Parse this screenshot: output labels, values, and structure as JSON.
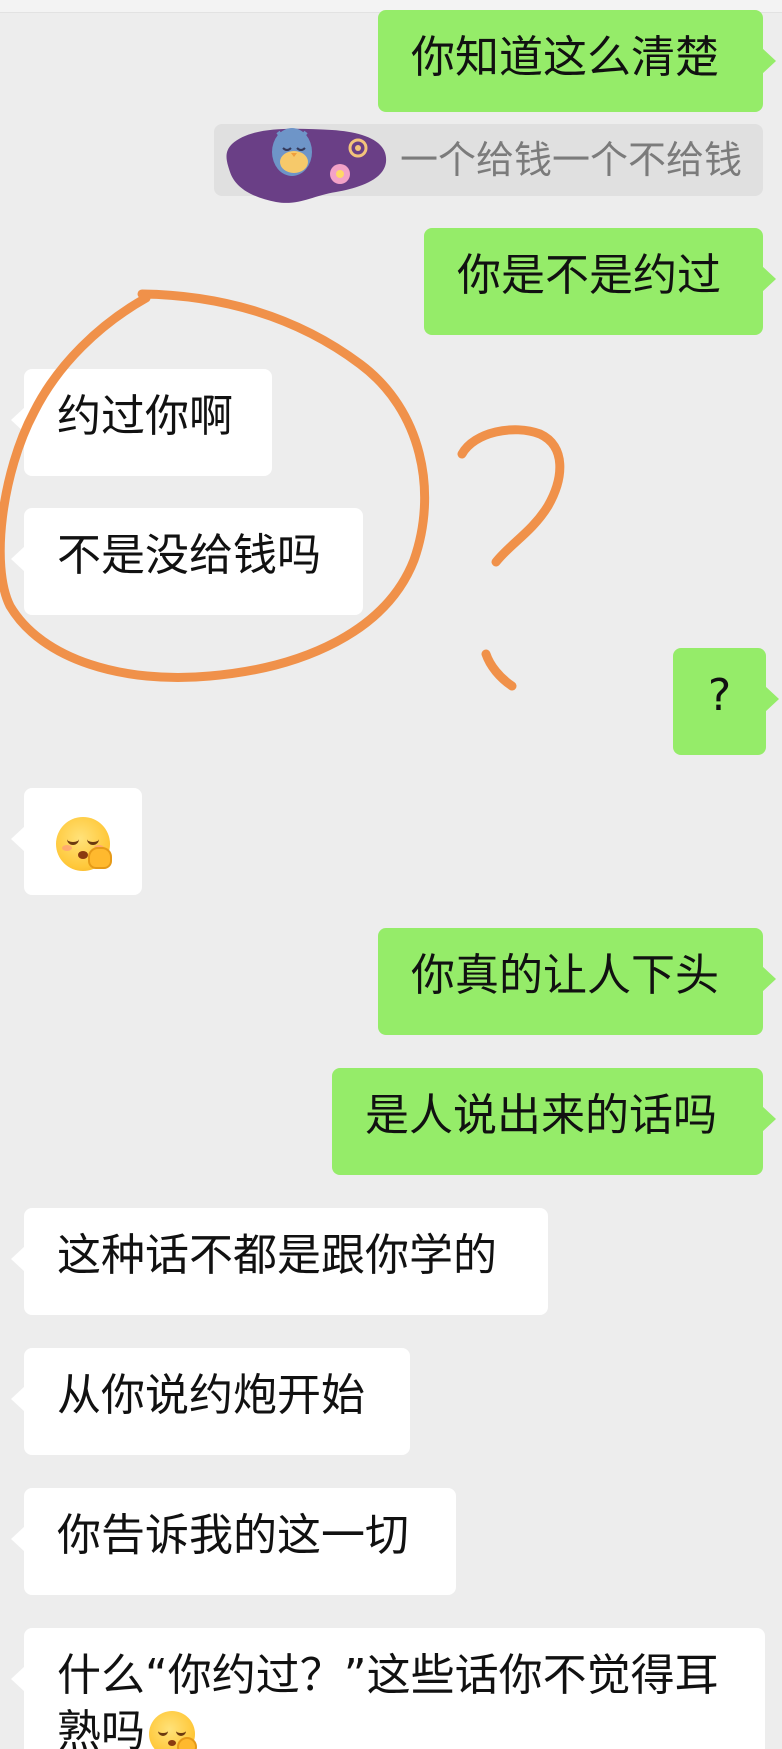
{
  "chat": {
    "messages": [
      {
        "side": "out",
        "text": "你知道这么清楚"
      },
      {
        "side": "quote",
        "text": "一个给钱一个不给钱"
      },
      {
        "side": "out",
        "text": "你是不是约过"
      },
      {
        "side": "in",
        "text": "约过你啊"
      },
      {
        "side": "in",
        "text": "不是没给钱吗"
      },
      {
        "side": "out",
        "text": "?"
      },
      {
        "side": "in",
        "text": "",
        "icon": "smirk-shushing-emoji-icon"
      },
      {
        "side": "out",
        "text": "你真的让人下头"
      },
      {
        "side": "out",
        "text": "是人说出来的话吗"
      },
      {
        "side": "in",
        "text": "这种话不都是跟你学的"
      },
      {
        "side": "in",
        "text": "从你说约炮开始"
      },
      {
        "side": "in",
        "text": "你告诉我的这一切"
      },
      {
        "side": "in",
        "text": "什么“你约过？”这些话你不觉得耳熟吗",
        "icon": "smirk-shushing-emoji-icon"
      }
    ]
  },
  "annotation": {
    "color": "#f0914a",
    "shapes": [
      "circle-icon",
      "question-mark-icon"
    ]
  },
  "colors": {
    "outgoing_bubble": "#95ec69",
    "incoming_bubble": "#ffffff",
    "background": "#ededed",
    "quote_bubble": "#e0e0e0"
  }
}
